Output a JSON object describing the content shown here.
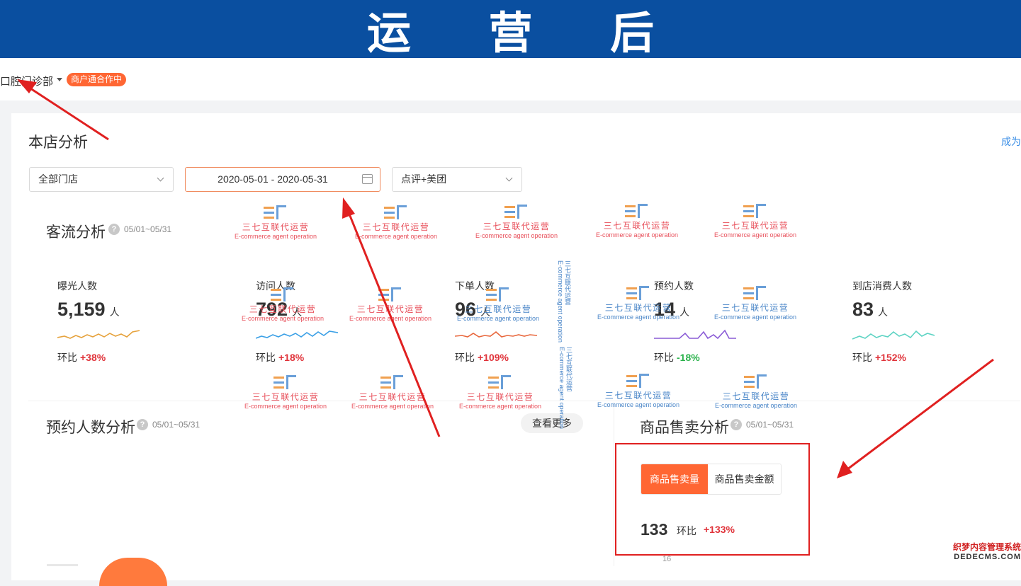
{
  "banner": {
    "title": "运 营 后"
  },
  "header": {
    "shop_name": "口腔门诊部",
    "status_badge": "商户通合作中"
  },
  "main": {
    "title": "本店分析",
    "right_link": "成为",
    "filters": {
      "store": "全部门店",
      "date_range": "2020-05-01 - 2020-05-31",
      "platform": "点评+美团"
    }
  },
  "traffic": {
    "title": "客流分析",
    "range": "05/01~05/31",
    "change_prefix": "环比",
    "metrics": [
      {
        "label": "曝光人数",
        "value": "5,159",
        "unit": "人",
        "change": "+38%",
        "trend": "up",
        "color": "#e6a23c"
      },
      {
        "label": "访问人数",
        "value": "792",
        "unit": "人",
        "change": "+18%",
        "trend": "up",
        "color": "#3ba0e6"
      },
      {
        "label": "下单人数",
        "value": "96",
        "unit": "人",
        "change": "+109%",
        "trend": "up",
        "color": "#e8663b"
      },
      {
        "label": "预约人数",
        "value": "14",
        "unit": "人",
        "change": "-18%",
        "trend": "down",
        "color": "#8a5bd6"
      },
      {
        "label": "到店消费人数",
        "value": "83",
        "unit": "人",
        "change": "+152%",
        "trend": "up",
        "color": "#5dd3c3"
      }
    ]
  },
  "appointments": {
    "title": "预约人数分析",
    "range": "05/01~05/31",
    "more_button": "查看更多"
  },
  "sales": {
    "title": "商品售卖分析",
    "range": "05/01~05/31",
    "tabs": [
      "商品售卖量",
      "商品售卖金额"
    ],
    "value": "133",
    "change_label": "环比",
    "change": "+133%",
    "axis_tick": "16"
  },
  "watermark": {
    "cn": "三七互联代运营",
    "en": "E-commerce agent operation"
  },
  "corner_watermark": {
    "line1": "织梦内容管理系统",
    "line2": "DEDECMS.COM"
  },
  "colors": {
    "banner": "#0a4fa0",
    "accent": "#ff6633",
    "arrow": "#e02020"
  }
}
